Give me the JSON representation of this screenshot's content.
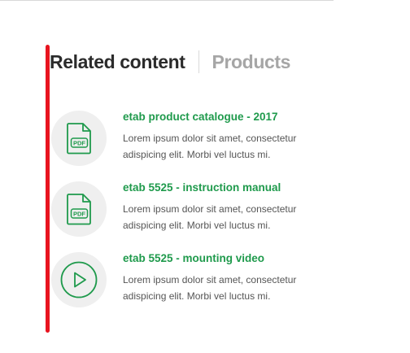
{
  "tabs": [
    {
      "label": "Related content",
      "active": true
    },
    {
      "label": "Products",
      "active": false
    }
  ],
  "items": [
    {
      "icon": "pdf-icon",
      "icon_label": "PDF",
      "title": "etab product catalogue - 2017",
      "desc_line1": "Lorem ipsum dolor sit amet, consectetur",
      "desc_line2": "adispicing elit. Morbi vel luctus mi."
    },
    {
      "icon": "pdf-icon",
      "icon_label": "PDF",
      "title": "etab 5525 - instruction manual",
      "desc_line1": "Lorem ipsum dolor sit amet, consectetur",
      "desc_line2": "adispicing elit. Morbi vel luctus mi."
    },
    {
      "icon": "play-icon",
      "title": "etab 5525 - mounting video",
      "desc_line1": "Lorem ipsum dolor sit amet, consectetur",
      "desc_line2": "adispicing elit. Morbi vel luctus mi."
    }
  ],
  "colors": {
    "accent_green": "#1f9a4c",
    "marker_red": "#e8141f",
    "icon_bg": "#efefef",
    "tab_active": "#2b2b2b",
    "tab_inactive": "#a6a6a6"
  }
}
